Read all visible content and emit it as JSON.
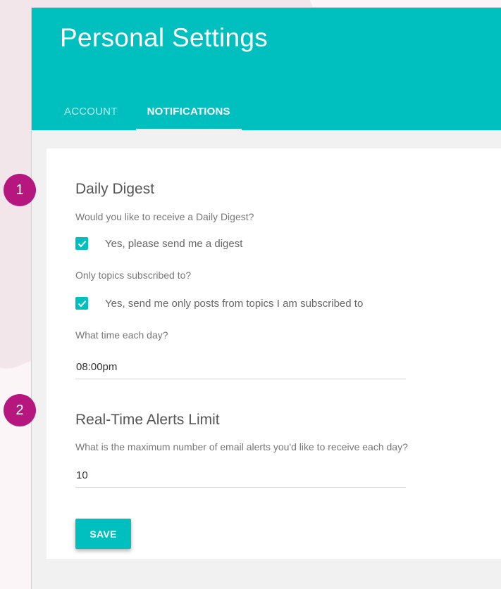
{
  "page": {
    "title": "Personal Settings"
  },
  "tabs": [
    {
      "label": "ACCOUNT",
      "active": false
    },
    {
      "label": "NOTIFICATIONS",
      "active": true
    }
  ],
  "steps": {
    "one": "1",
    "two": "2"
  },
  "daily_digest": {
    "title": "Daily Digest",
    "question": "Would you like to receive a Daily Digest?",
    "option_label": "Yes, please send me a digest",
    "option_checked": true,
    "topics_question": "Only topics subscribed to?",
    "topics_option_label": "Yes, send me only posts from topics I am subscribed to",
    "topics_option_checked": true,
    "time_question": "What time each day?",
    "time_value": "08:00pm"
  },
  "alerts": {
    "title": "Real-Time Alerts Limit",
    "question": "What is the maximum number of email alerts you'd like to receive each day?",
    "limit_value": "10"
  },
  "actions": {
    "save_label": "SAVE"
  },
  "colors": {
    "accent": "#00bfbf",
    "badge": "#b5177f"
  },
  "icons": {
    "checkbox": "checkmark-icon"
  }
}
